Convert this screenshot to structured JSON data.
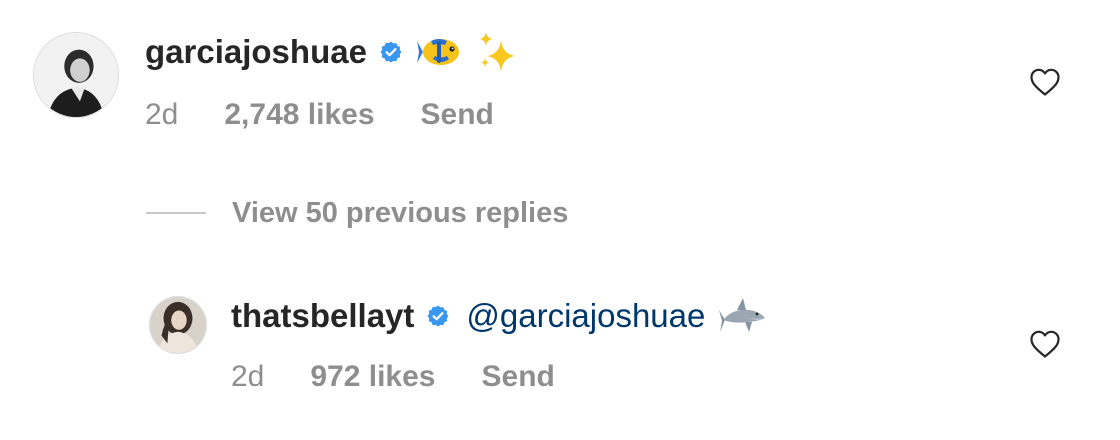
{
  "comment": {
    "username": "garciajoshuae",
    "verified": true,
    "text_icons": [
      "tropical-fish-icon",
      "sparkles-icon"
    ],
    "time": "2d",
    "likes": "2,748 likes",
    "send_label": "Send",
    "liked": false
  },
  "view_replies": {
    "label": "View 50 previous replies"
  },
  "reply": {
    "username": "thatsbellayt",
    "verified": true,
    "mention": "@garciajoshuae",
    "text_icons": [
      "shark-icon"
    ],
    "time": "2d",
    "likes": "972 likes",
    "send_label": "Send",
    "liked": false
  },
  "colors": {
    "text_primary": "#262626",
    "text_secondary": "#8e8e8e",
    "mention": "#00376b",
    "verified_badge": "#3897f0",
    "background": "#ffffff"
  }
}
